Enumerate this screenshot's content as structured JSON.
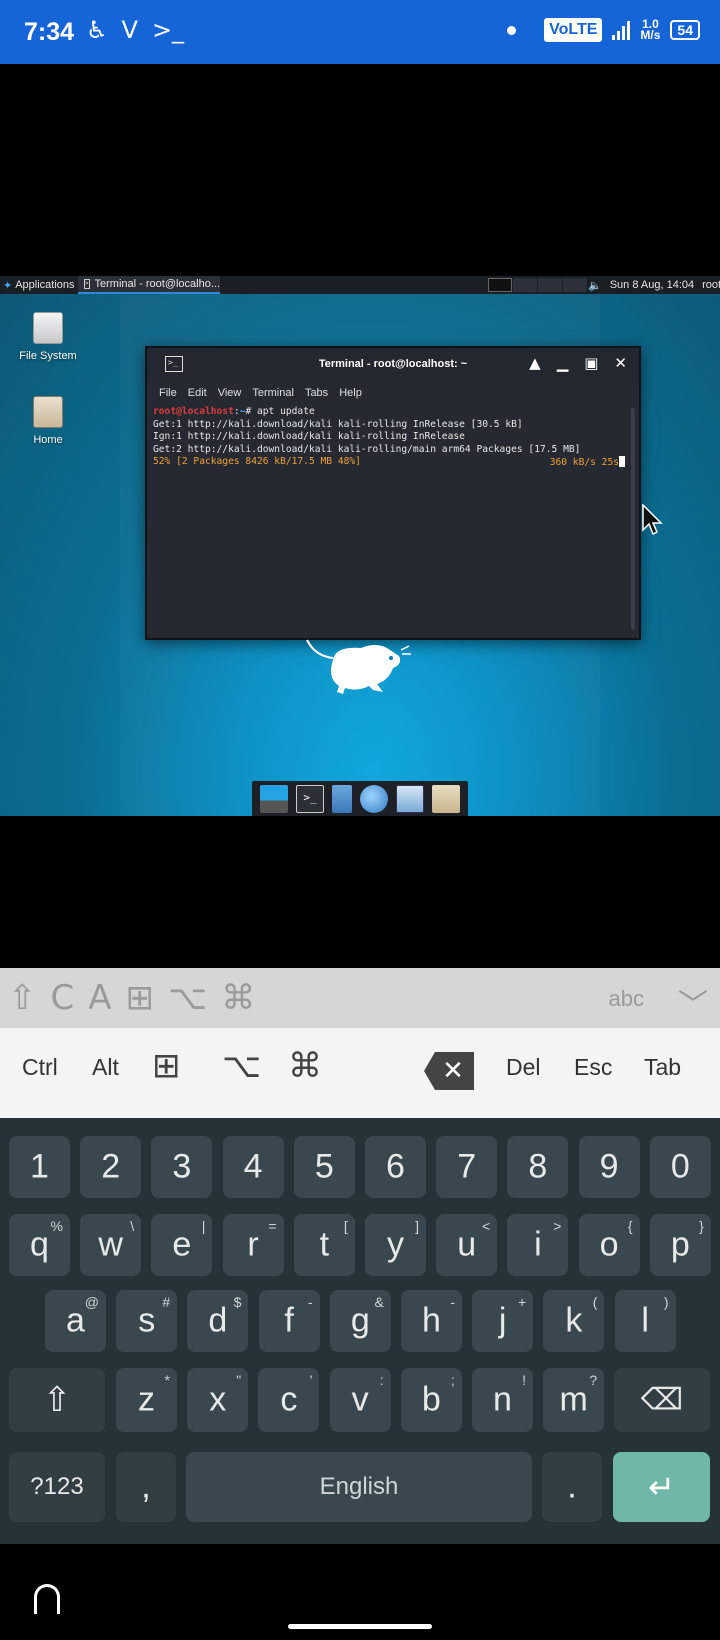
{
  "statusbar": {
    "time": "7:34",
    "volte": "VoLTE",
    "speed_value": "1.0",
    "speed_unit": "M/s",
    "battery": "54"
  },
  "desktop": {
    "panel": {
      "applications": "Applications",
      "window_title": "Terminal - root@localho...",
      "clock": "Sun 8 Aug, 14:04",
      "user": "root"
    },
    "icons": [
      {
        "label": "File System"
      },
      {
        "label": "Home"
      }
    ],
    "terminal": {
      "title": "Terminal - root@localhost: ~",
      "menu": [
        "File",
        "Edit",
        "View",
        "Terminal",
        "Tabs",
        "Help"
      ],
      "prompt_user": "root@localhost",
      "prompt_sep": ":",
      "prompt_path": "~",
      "command": "# apt update",
      "lines": [
        "Get:1 http://kali.download/kali kali-rolling InRelease [30.5 kB]",
        "Ign:1 http://kali.download/kali kali-rolling InRelease",
        "Get:2 http://kali.download/kali kali-rolling/main arm64 Packages [17.5 MB]"
      ],
      "progress_line": "52% [2 Packages 8426 kB/17.5 MB 48%]",
      "rate": "360 kB/s 25s"
    }
  },
  "keyboard_extra": {
    "row1_right": "abc",
    "ctrl": "Ctrl",
    "alt": "Alt",
    "del": "Del",
    "esc": "Esc",
    "tab": "Tab"
  },
  "keyboard": {
    "numbers": [
      "1",
      "2",
      "3",
      "4",
      "5",
      "6",
      "7",
      "8",
      "9",
      "0"
    ],
    "row1": [
      {
        "k": "q",
        "s": "%"
      },
      {
        "k": "w",
        "s": "\\"
      },
      {
        "k": "e",
        "s": "|"
      },
      {
        "k": "r",
        "s": "="
      },
      {
        "k": "t",
        "s": "["
      },
      {
        "k": "y",
        "s": "]"
      },
      {
        "k": "u",
        "s": "<"
      },
      {
        "k": "i",
        "s": ">"
      },
      {
        "k": "o",
        "s": "{"
      },
      {
        "k": "p",
        "s": "}"
      }
    ],
    "row2": [
      {
        "k": "a",
        "s": "@"
      },
      {
        "k": "s",
        "s": "#"
      },
      {
        "k": "d",
        "s": "$"
      },
      {
        "k": "f",
        "s": "-"
      },
      {
        "k": "g",
        "s": "&"
      },
      {
        "k": "h",
        "s": "-"
      },
      {
        "k": "j",
        "s": "+"
      },
      {
        "k": "k",
        "s": "("
      },
      {
        "k": "l",
        "s": ")"
      }
    ],
    "row3": [
      {
        "k": "z",
        "s": "*"
      },
      {
        "k": "x",
        "s": "\""
      },
      {
        "k": "c",
        "s": "'"
      },
      {
        "k": "v",
        "s": ":"
      },
      {
        "k": "b",
        "s": ";"
      },
      {
        "k": "n",
        "s": "!"
      },
      {
        "k": "m",
        "s": "?"
      }
    ],
    "symbols": "?123",
    "comma": ",",
    "space": "English",
    "period": "."
  }
}
